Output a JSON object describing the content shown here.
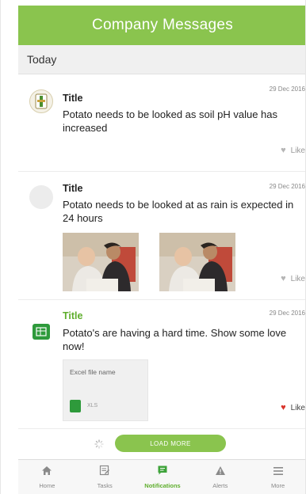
{
  "header": {
    "title": "Company Messages"
  },
  "section": {
    "label": "Today"
  },
  "messages": [
    {
      "title": "Title",
      "date": "29 Dec 2016",
      "body": "Potato needs to be looked as soil pH value has increased",
      "like_label": "Like",
      "liked": false,
      "avatar_icon": "company-logo-icon"
    },
    {
      "title": "Title",
      "date": "29 Dec 2016",
      "body": "Potato needs to be looked at as rain is expected in 24 hours",
      "like_label": "Like",
      "liked": false,
      "avatar_icon": "blank-avatar"
    },
    {
      "title": "Title",
      "date": "29 Dec 2016",
      "body": "Potato's are having a hard time. Show some love now!",
      "like_label": "Like",
      "liked": true,
      "avatar_icon": "excel-file-icon",
      "attachment": {
        "name": "Excel file name",
        "ext": "XLS"
      }
    }
  ],
  "load_more": {
    "label": "LOAD MORE"
  },
  "tabs": [
    {
      "label": "Home",
      "icon": "home-icon",
      "active": false
    },
    {
      "label": "Tasks",
      "icon": "tasks-icon",
      "active": false
    },
    {
      "label": "Notifications",
      "icon": "notifications-icon",
      "active": true
    },
    {
      "label": "Alerts",
      "icon": "alert-icon",
      "active": false
    },
    {
      "label": "More",
      "icon": "menu-icon",
      "active": false
    }
  ],
  "colors": {
    "brand": "#8ac44e",
    "accent_text": "#5fae2d",
    "like_active": "#d9342b",
    "xls": "#2e9a3b"
  }
}
